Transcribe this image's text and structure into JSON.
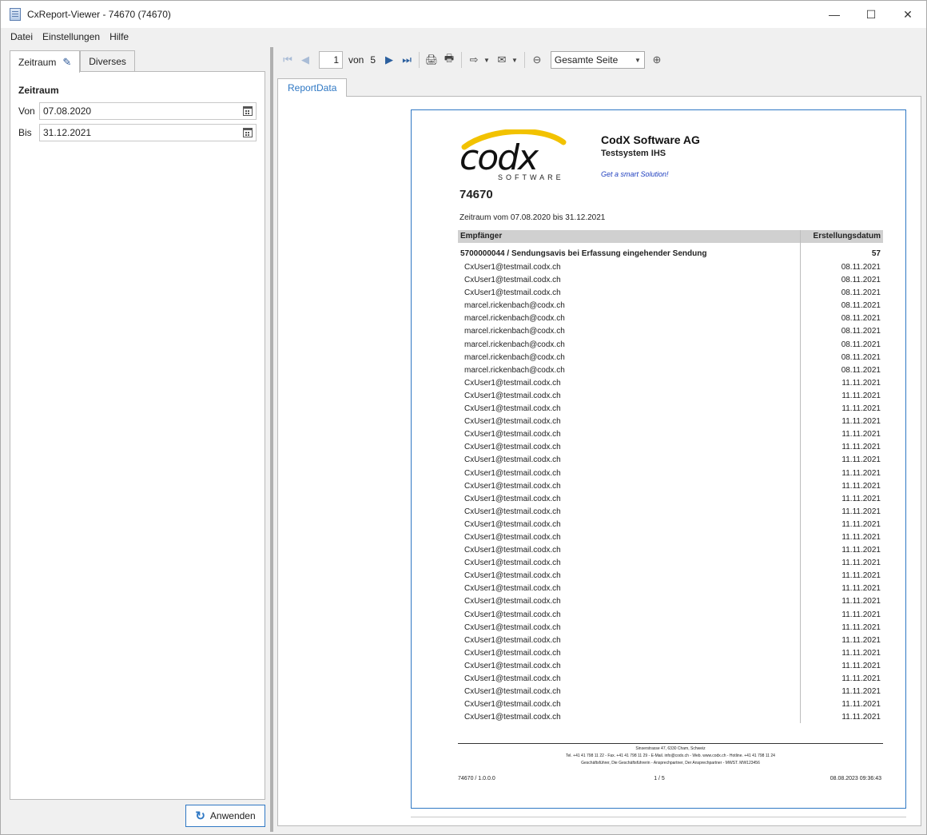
{
  "window": {
    "title": "CxReport-Viewer - 74670 (74670)"
  },
  "menu": {
    "items": [
      "Datei",
      "Einstellungen",
      "Hilfe"
    ]
  },
  "left_panel": {
    "tabs": [
      "Zeitraum",
      "Diverses"
    ],
    "section_title": "Zeitraum",
    "from_label": "Von",
    "from_value": "07.08.2020",
    "to_label": "Bis",
    "to_value": "31.12.2021",
    "apply_label": "Anwenden"
  },
  "toolbar": {
    "page_value": "1",
    "of_label": "von",
    "page_count": "5",
    "zoom_value": "Gesamte Seite"
  },
  "report_tab": "ReportData",
  "report": {
    "company": "CodX Software AG",
    "system": "Testsystem IHS",
    "slogan": "Get a smart Solution!",
    "logo_text": "codx",
    "logo_sub": "SOFTWARE",
    "title": "74670",
    "period": "Zeitraum vom 07.08.2020 bis 31.12.2021",
    "col_recipient": "Empfänger",
    "col_date": "Erstellungsdatum",
    "group_label": "5700000044 / Sendungsavis bei Erfassung eingehender Sendung",
    "group_count": "57",
    "rows": [
      {
        "r": "CxUser1@testmail.codx.ch",
        "d": "08.11.2021"
      },
      {
        "r": "CxUser1@testmail.codx.ch",
        "d": "08.11.2021"
      },
      {
        "r": "CxUser1@testmail.codx.ch",
        "d": "08.11.2021"
      },
      {
        "r": "marcel.rickenbach@codx.ch",
        "d": "08.11.2021"
      },
      {
        "r": "marcel.rickenbach@codx.ch",
        "d": "08.11.2021"
      },
      {
        "r": "marcel.rickenbach@codx.ch",
        "d": "08.11.2021"
      },
      {
        "r": "marcel.rickenbach@codx.ch",
        "d": "08.11.2021"
      },
      {
        "r": "marcel.rickenbach@codx.ch",
        "d": "08.11.2021"
      },
      {
        "r": "marcel.rickenbach@codx.ch",
        "d": "08.11.2021"
      },
      {
        "r": "CxUser1@testmail.codx.ch",
        "d": "11.11.2021"
      },
      {
        "r": "CxUser1@testmail.codx.ch",
        "d": "11.11.2021"
      },
      {
        "r": "CxUser1@testmail.codx.ch",
        "d": "11.11.2021"
      },
      {
        "r": "CxUser1@testmail.codx.ch",
        "d": "11.11.2021"
      },
      {
        "r": "CxUser1@testmail.codx.ch",
        "d": "11.11.2021"
      },
      {
        "r": "CxUser1@testmail.codx.ch",
        "d": "11.11.2021"
      },
      {
        "r": "CxUser1@testmail.codx.ch",
        "d": "11.11.2021"
      },
      {
        "r": "CxUser1@testmail.codx.ch",
        "d": "11.11.2021"
      },
      {
        "r": "CxUser1@testmail.codx.ch",
        "d": "11.11.2021"
      },
      {
        "r": "CxUser1@testmail.codx.ch",
        "d": "11.11.2021"
      },
      {
        "r": "CxUser1@testmail.codx.ch",
        "d": "11.11.2021"
      },
      {
        "r": "CxUser1@testmail.codx.ch",
        "d": "11.11.2021"
      },
      {
        "r": "CxUser1@testmail.codx.ch",
        "d": "11.11.2021"
      },
      {
        "r": "CxUser1@testmail.codx.ch",
        "d": "11.11.2021"
      },
      {
        "r": "CxUser1@testmail.codx.ch",
        "d": "11.11.2021"
      },
      {
        "r": "CxUser1@testmail.codx.ch",
        "d": "11.11.2021"
      },
      {
        "r": "CxUser1@testmail.codx.ch",
        "d": "11.11.2021"
      },
      {
        "r": "CxUser1@testmail.codx.ch",
        "d": "11.11.2021"
      },
      {
        "r": "CxUser1@testmail.codx.ch",
        "d": "11.11.2021"
      },
      {
        "r": "CxUser1@testmail.codx.ch",
        "d": "11.11.2021"
      },
      {
        "r": "CxUser1@testmail.codx.ch",
        "d": "11.11.2021"
      },
      {
        "r": "CxUser1@testmail.codx.ch",
        "d": "11.11.2021"
      },
      {
        "r": "CxUser1@testmail.codx.ch",
        "d": "11.11.2021"
      },
      {
        "r": "CxUser1@testmail.codx.ch",
        "d": "11.11.2021"
      },
      {
        "r": "CxUser1@testmail.codx.ch",
        "d": "11.11.2021"
      },
      {
        "r": "CxUser1@testmail.codx.ch",
        "d": "11.11.2021"
      },
      {
        "r": "CxUser1@testmail.codx.ch",
        "d": "11.11.2021"
      }
    ],
    "footer_address": "Sinserstrasse 47, 6330 Cham, Schweiz",
    "footer_contact": "Tel. +41 41 798 11 22 - Fax. +41 41 798 11 29 - E-Mail. info@codx.ch - Web. www.codx.ch - Hotline. +41 41 798 11 24",
    "footer_mgmt": "Geschäftsführer, Die Geschäftsführerin - Ansprechpartner, Der Ansprechpartner - MWST. MW123456",
    "footer_left": "74670 / 1.0.0.0",
    "footer_page": "1 / 5",
    "footer_right": "08.08.2023 09:36:43"
  },
  "colors": {
    "accent": "#2f78c4",
    "logo_yellow": "#f2c200"
  }
}
